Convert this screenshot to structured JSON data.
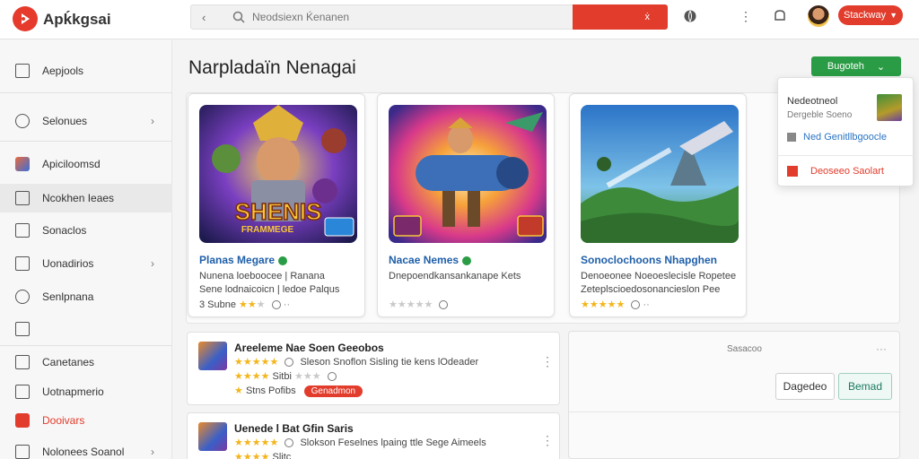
{
  "header": {
    "app_name": "Apḱkgsai",
    "search_placeholder": "Nɐodsiexn Ḱenanen",
    "search_button": "ẋ ",
    "cta_label": "Stackway"
  },
  "sidebar": {
    "items": [
      {
        "label": "Aepjools",
        "icon": "square-outline-icon"
      },
      {
        "label": "Selonues",
        "icon": "gear-icon",
        "chevron": true
      },
      {
        "label": "Apiciloomsd",
        "icon": "avatar-icon",
        "active": false
      },
      {
        "label": "Ncokhen Ieaes",
        "icon": "library-icon",
        "active": true
      },
      {
        "label": "Sonaclos",
        "icon": "list-icon"
      },
      {
        "label": "Uonadirios",
        "icon": "folder-icon",
        "chevron": true
      },
      {
        "label": "Senlpnana",
        "icon": "gear-icon"
      },
      {
        "label": "",
        "icon": "checkbox-icon"
      },
      {
        "label": "Canetanes",
        "icon": "monitor-icon"
      },
      {
        "label": "Uotnapmerio",
        "icon": "calendar-icon"
      },
      {
        "label": "Dooivars",
        "icon": "red-video-icon",
        "highlight": true
      },
      {
        "label": "Nolonees Soanol",
        "icon": "shield-icon",
        "chevron": true
      }
    ]
  },
  "main": {
    "title": "Narpladaïn Nenagai",
    "primary_button": "Bugoteh",
    "cards": [
      {
        "title": "Planas Megare",
        "desc_line1": "Nunena loeboocee | Ranana",
        "desc_line2": "Sene lodnaicoicn | ledoe Palqus",
        "rating_text": "3 Subne",
        "stars": 2,
        "art": "art-heroes",
        "art_caption": "SHENIS",
        "art_sub": "FRAMMEGE"
      },
      {
        "title": "Nacae Nemes",
        "desc_line1": "Dnepoendkansankanape Kets",
        "desc_line2": "",
        "rating_text": "",
        "stars": 0,
        "art": "art-cannon"
      },
      {
        "title": "Sonoclochoons Nhapghen",
        "desc_line1": "Denoeonee Noeoeslecisle Ropetee",
        "desc_line2": "Zeteplscioedosonancieslon Pee",
        "rating_text": "",
        "stars": 5,
        "art": "art-landscape"
      }
    ]
  },
  "dropdown": {
    "title": "Nedeotneol",
    "subtitle": "Dergeble Soeno",
    "link": "Ned Genitllbgoocle",
    "danger": "Deoseeo Saolart"
  },
  "list": [
    {
      "title": "Areeleme Nae Soen Geeobos",
      "line1": "Sleson Snoflon Sisling tie kens lOdeader",
      "line2_prefix": "Sitbi",
      "line3_prefix": "Stns Pofibs",
      "badge": "Genadmon"
    },
    {
      "title": "Uenede l Bat Gfin Saris",
      "line1": "Slokson Feselnes lpaing ttle Sege Aimeels",
      "line2_prefix": "Slitc"
    }
  ],
  "right_panel": {
    "label": "Sasacoo",
    "btn_secondary": "Dagedeo",
    "btn_primary": "Bemad"
  },
  "colors": {
    "brand_red": "#e23c2c",
    "accent_green": "#2a9c45",
    "link_blue": "#1f5fa9"
  }
}
